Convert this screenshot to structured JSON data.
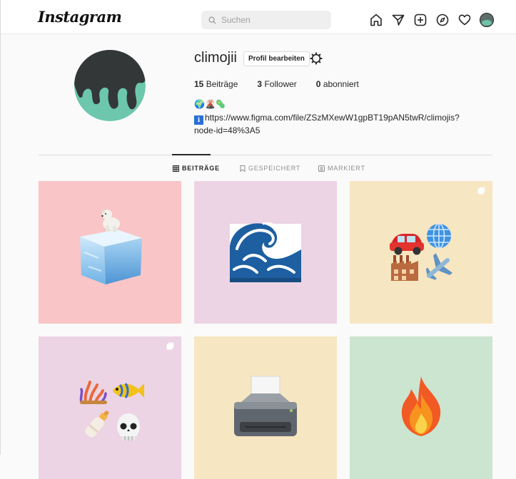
{
  "header": {
    "logo": "Instagram",
    "search_placeholder": "Suchen",
    "nav_icons": [
      "home-icon",
      "direct-icon",
      "new-post-icon",
      "explore-icon",
      "activity-icon",
      "profile-avatar-icon"
    ]
  },
  "profile": {
    "username": "climojii",
    "edit_button": "Profil bearbeiten",
    "stats": {
      "posts_count": "15",
      "posts_label": "Beiträge",
      "followers_count": "3",
      "followers_label": "Follower",
      "following_count": "0",
      "following_label": "abonniert"
    },
    "bio_emoji": "🌍🌋🦠",
    "bio_link_icon": "ℹ",
    "bio_link": "https://www.figma.com/file/ZSzMXewW1gpBT19pAN5twR/climojis?node-id=48%3A5"
  },
  "tabs": [
    {
      "label": "BEITRÄGE",
      "active": true
    },
    {
      "label": "GESPEICHERT",
      "active": false
    },
    {
      "label": "MARKIERT",
      "active": false
    }
  ],
  "posts": [
    {
      "bg": "#f9c5c6",
      "emoji": "polar-bear-on-ice-cube",
      "multi": false
    },
    {
      "bg": "#ecd4e4",
      "emoji": "water-wave",
      "multi": false
    },
    {
      "bg": "#f7e6c2",
      "emoji": "car-globe-factory-airplane",
      "multi": true
    },
    {
      "bg": "#ecd4e4",
      "emoji": "coral-fish-bottle-skull",
      "multi": true
    },
    {
      "bg": "#f7e6c2",
      "emoji": "printer",
      "multi": false
    },
    {
      "bg": "#cce5d0",
      "emoji": "fire",
      "multi": false
    }
  ]
}
